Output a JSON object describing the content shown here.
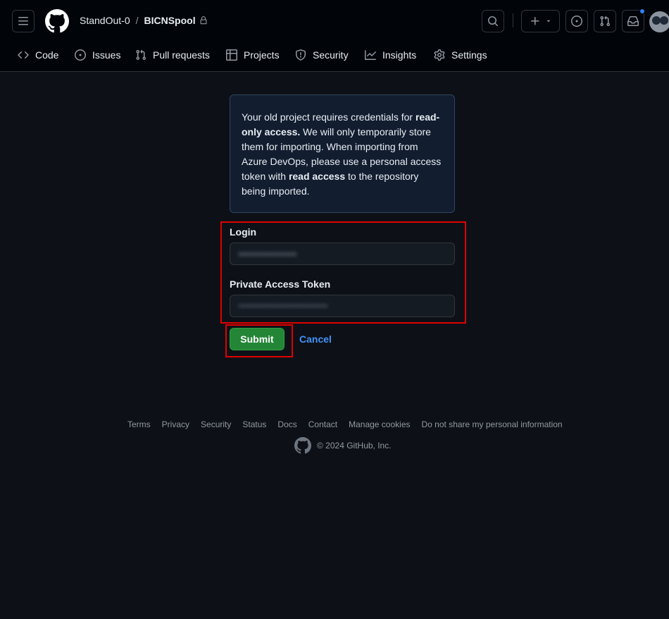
{
  "header": {
    "owner": "StandOut-0",
    "separator": "/",
    "repo": "BICNSpool"
  },
  "nav": {
    "items": [
      {
        "label": "Code",
        "icon": "code-icon"
      },
      {
        "label": "Issues",
        "icon": "issue-opened-icon"
      },
      {
        "label": "Pull requests",
        "icon": "git-pull-request-icon"
      },
      {
        "label": "Projects",
        "icon": "table-icon"
      },
      {
        "label": "Security",
        "icon": "shield-icon"
      },
      {
        "label": "Insights",
        "icon": "graph-icon"
      },
      {
        "label": "Settings",
        "icon": "gear-icon"
      }
    ]
  },
  "info": {
    "part1": "Your old project requires credentials for ",
    "bold1": "read-only access.",
    "part2": " We will only temporarily store them for importing. When importing from Azure DevOps, please use a personal access token with ",
    "bold2": "read access",
    "part3": " to the repository being imported."
  },
  "form": {
    "login_label": "Login",
    "login_value": "••••••••••••••",
    "token_label": "Private Access Token",
    "token_value": "••••••••••••••••••••••••••••••••••••••••",
    "submit_label": "Submit",
    "cancel_label": "Cancel"
  },
  "footer": {
    "links": [
      "Terms",
      "Privacy",
      "Security",
      "Status",
      "Docs",
      "Contact",
      "Manage cookies",
      "Do not share my personal information"
    ],
    "copyright": "© 2024 GitHub, Inc."
  },
  "colors": {
    "background": "#0d1117",
    "header_bg": "#010409",
    "accent_link": "#4493f8",
    "submit_green": "#238636",
    "highlight_red": "#e00000",
    "notification_dot": "#2f81f7"
  }
}
